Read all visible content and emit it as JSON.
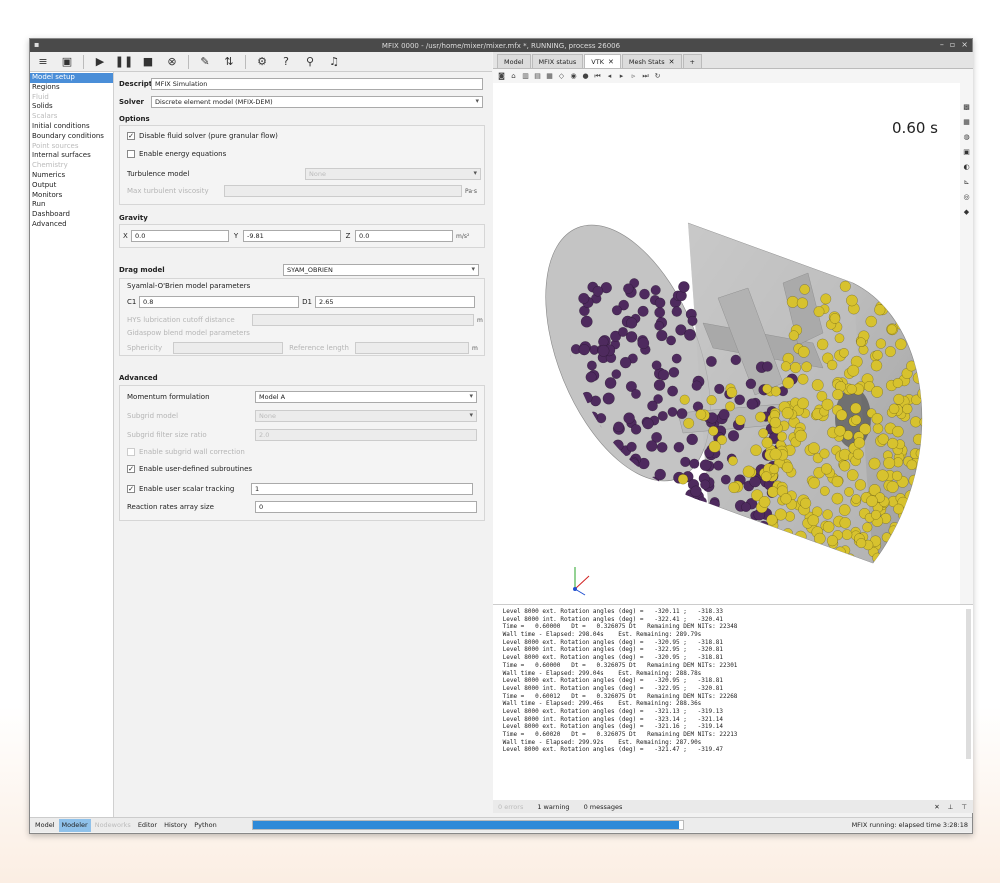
{
  "window": {
    "title": "MFIX 0000 - /usr/home/mixer/mixer.mfx *, RUNNING, process 26006"
  },
  "toolbar": {
    "icons": [
      "menu-icon",
      "save-icon",
      "play-icon",
      "pause-icon",
      "stop-icon",
      "reset-icon",
      "build-icon",
      "parameters-icon",
      "settings-icon",
      "help-icon",
      "search-icon",
      "notification-icon"
    ]
  },
  "nav": {
    "items": [
      {
        "label": "Model setup",
        "state": "active"
      },
      {
        "label": "Regions",
        "state": "normal"
      },
      {
        "label": "Fluid",
        "state": "disabled"
      },
      {
        "label": "Solids",
        "state": "normal"
      },
      {
        "label": "Scalars",
        "state": "disabled"
      },
      {
        "label": "Initial conditions",
        "state": "normal"
      },
      {
        "label": "Boundary conditions",
        "state": "normal"
      },
      {
        "label": "Point sources",
        "state": "disabled"
      },
      {
        "label": "Internal surfaces",
        "state": "normal"
      },
      {
        "label": "Chemistry",
        "state": "disabled"
      },
      {
        "label": "Numerics",
        "state": "normal"
      },
      {
        "label": "Output",
        "state": "normal"
      },
      {
        "label": "Monitors",
        "state": "normal"
      },
      {
        "label": "Run",
        "state": "normal"
      },
      {
        "label": "Dashboard",
        "state": "normal"
      },
      {
        "label": "Advanced",
        "state": "normal"
      }
    ]
  },
  "form": {
    "description_label": "Description",
    "description_value": "MFIX Simulation",
    "solver_label": "Solver",
    "solver_value": "Discrete element model (MFIX-DEM)",
    "options_title": "Options",
    "disable_fluid_label": "Disable fluid solver (pure granular flow)",
    "enable_energy_label": "Enable energy equations",
    "turbulence_label": "Turbulence model",
    "turbulence_value": "None",
    "max_visc_label": "Max turbulent viscosity",
    "max_visc_unit": "Pa·s",
    "gravity_title": "Gravity",
    "gx_label": "X",
    "gx_value": "0.0",
    "gy_label": "Y",
    "gy_value": "-9.81",
    "gz_label": "Z",
    "gz_value": "0.0",
    "gravity_unit": "m/s²",
    "drag_label": "Drag model",
    "drag_value": "SYAM_OBRIEN",
    "syam_params_label": "Syamlal-O'Brien model parameters",
    "c1_label": "C1",
    "c1_value": "0.8",
    "d1_label": "D1",
    "d1_value": "2.65",
    "hys_label": "HYS lubrication cutoff distance",
    "hys_unit": "m",
    "gidaspow_label": "Gidaspow blend model parameters",
    "sphericity_label": "Sphericity",
    "ref_length_label": "Reference length",
    "ref_length_unit": "m",
    "advanced_title": "Advanced",
    "momentum_label": "Momentum formulation",
    "momentum_value": "Model A",
    "subgrid_model_label": "Subgrid model",
    "subgrid_model_value": "None",
    "subgrid_ratio_label": "Subgrid filter size ratio",
    "subgrid_ratio_value": "2.0",
    "subgrid_wall_label": "Enable subgrid wall correction",
    "user_subroutines_label": "Enable user-defined subroutines",
    "user_scalar_label": "Enable user scalar tracking",
    "user_scalar_value": "1",
    "reaction_rates_label": "Reaction rates array size",
    "reaction_rates_value": "0"
  },
  "tabs": [
    {
      "label": "Model",
      "active": false,
      "closable": false
    },
    {
      "label": "MFIX status",
      "active": false,
      "closable": false
    },
    {
      "label": "VTK",
      "active": true,
      "closable": true
    },
    {
      "label": "Mesh Stats",
      "active": false,
      "closable": true
    },
    {
      "label": "+",
      "active": false,
      "closable": false
    }
  ],
  "viewport": {
    "time": "0.60 s",
    "vtk_tool_icons": [
      "camera-icon",
      "reset-view-icon",
      "xy-icon",
      "xz-icon",
      "yz-icon",
      "perspective-icon",
      "screenshot-icon",
      "record-icon",
      "first-frame-icon",
      "prev-frame-icon",
      "play-frame-icon",
      "next-frame-icon",
      "last-frame-icon",
      "loop-icon"
    ],
    "side_icons": [
      "geometry-icon",
      "mesh-icon",
      "particles-icon",
      "regions-icon",
      "background-icon",
      "axes-icon",
      "visibility-icon",
      "color-icon"
    ],
    "colors": {
      "purple": "#4e2a5e",
      "yellow": "#d7c22e",
      "drum": "#c8c8c8"
    }
  },
  "console": {
    "lines": [
      " Level 8000 ext. Rotation angles (deg) =   -320.11 ;   -318.33",
      " Level 8000 int. Rotation angles (deg) =   -322.41 ;   -320.41",
      " Time =   0.60000   Dt =   0.326075 Dt   Remaining DEM NITs: 22348",
      " Wall time - Elapsed: 298.04s    Est. Remaining: 289.79s",
      " Level 8000 ext. Rotation angles (deg) =   -320.95 ;   -318.81",
      " Level 8000 int. Rotation angles (deg) =   -322.95 ;   -320.81",
      " Level 8000 ext. Rotation angles (deg) =   -320.95 ;   -318.81",
      " Time =   0.60000   Dt =   0.326075 Dt   Remaining DEM NITs: 22301",
      " Wall time - Elapsed: 299.04s    Est. Remaining: 288.78s",
      " Level 8000 ext. Rotation angles (deg) =   -320.95 ;   -318.81",
      " Level 8000 int. Rotation angles (deg) =   -322.95 ;   -320.81",
      " Time =   0.60012   Dt =   0.326075 Dt   Remaining DEM NITs: 22268",
      " Wall time - Elapsed: 299.46s    Est. Remaining: 288.36s",
      " Level 8000 ext. Rotation angles (deg) =   -321.13 ;   -319.13",
      " Level 8000 int. Rotation angles (deg) =   -323.14 ;   -321.14",
      " Level 8000 ext. Rotation angles (deg) =   -321.16 ;   -319.14",
      " Time =   0.60020   Dt =   0.326075 Dt   Remaining DEM NITs: 22213",
      " Wall time - Elapsed: 299.92s    Est. Remaining: 287.90s",
      " Level 8000 ext. Rotation angles (deg) =   -321.47 ;   -319.47"
    ],
    "errors": "0 errors",
    "warnings": "1 warning",
    "messages": "0 messages"
  },
  "statusbar": {
    "modes": [
      {
        "label": "Model",
        "state": "normal"
      },
      {
        "label": "Modeler",
        "state": "active"
      },
      {
        "label": "Nodeworks",
        "state": "disabled"
      },
      {
        "label": "Editor",
        "state": "normal"
      },
      {
        "label": "History",
        "state": "normal"
      },
      {
        "label": "Python",
        "state": "normal"
      }
    ],
    "progress": 0.99,
    "status_text": "MFIX running: elapsed time 3:28:18"
  }
}
